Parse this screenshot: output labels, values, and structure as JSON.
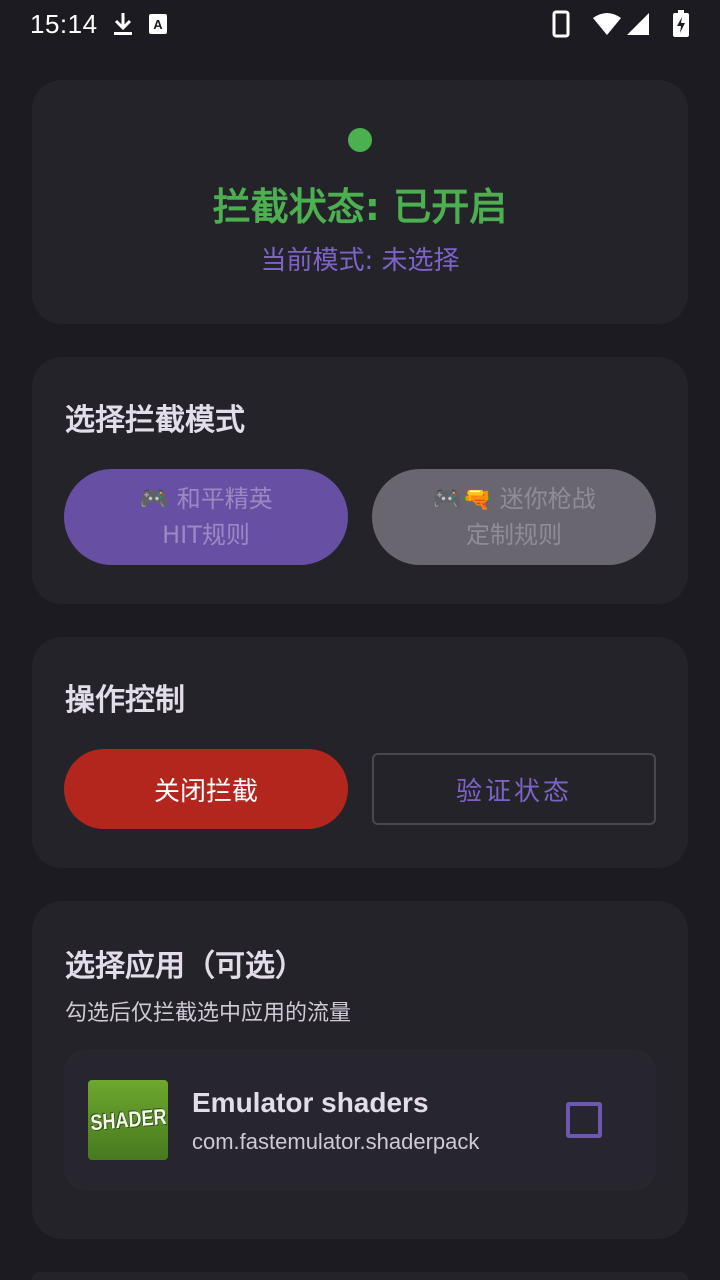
{
  "status_bar": {
    "time": "15:14",
    "icons": [
      "download-icon",
      "font-a-icon",
      "phone-icon",
      "wifi-icon",
      "signal-icon",
      "battery-charging-icon"
    ]
  },
  "status_card": {
    "title": "拦截状态: 已开启",
    "mode": "当前模式: 未选择",
    "dot_color": "#4caf50"
  },
  "mode_card": {
    "title": "选择拦截模式",
    "option_a": {
      "line1": "🎮 和平精英",
      "line2": "HIT规则"
    },
    "option_b": {
      "line1": "🎮🔫 迷你枪战",
      "line2": "定制规则"
    }
  },
  "control_card": {
    "title": "操作控制",
    "close_label": "关闭拦截",
    "verify_label": "验证状态"
  },
  "app_card": {
    "title": "选择应用（可选）",
    "subtitle": "勾选后仅拦截选中应用的流量",
    "apps": [
      {
        "icon_text": "SHADER",
        "name": "Emulator shaders",
        "package": "com.fastemulator.shaderpack",
        "checked": false
      }
    ]
  },
  "colors": {
    "accent_green": "#4caf50",
    "primary_purple": "#6750a4",
    "danger_red": "#b3261e",
    "background": "#1c1b21",
    "card": "#242329"
  }
}
